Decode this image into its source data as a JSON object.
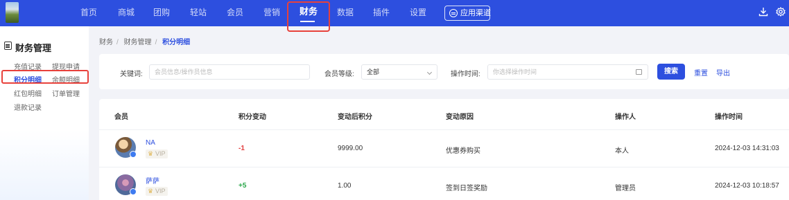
{
  "nav": {
    "items": [
      "首页",
      "商城",
      "团购",
      "轻站",
      "会员",
      "营销",
      "财务",
      "数据",
      "插件",
      "设置"
    ],
    "active": "财务",
    "channel_button": "应用渠道",
    "icons": [
      "download-icon",
      "gear-icon"
    ]
  },
  "sidebar": {
    "title": "财务管理",
    "links": [
      "充值记录",
      "提现申请",
      "积分明细",
      "余额明细",
      "红包明细",
      "订单管理",
      "退款记录"
    ],
    "active": "积分明细"
  },
  "breadcrumb": [
    "财务",
    "财务管理",
    "积分明细"
  ],
  "filters": {
    "keyword_label": "关键词:",
    "keyword_placeholder": "会员信息/操作员信息",
    "level_label": "会员等级:",
    "level_value": "全部",
    "time_label": "操作时间:",
    "time_placeholder": "你选择操作时间",
    "search_button": "搜索",
    "reset_button": "重置",
    "export_button": "导出"
  },
  "table": {
    "headers": [
      "会员",
      "积分变动",
      "变动后积分",
      "变动原因",
      "操作人",
      "操作时间"
    ],
    "rows": [
      {
        "name": "NA",
        "vip": "VIP",
        "change": "-1",
        "after": "9999.00",
        "reason": "优惠券购买",
        "operator": "本人",
        "time": "2024-12-03 14:31:03"
      },
      {
        "name": "萨萨",
        "vip": "VIP",
        "change": "+5",
        "after": "1.00",
        "reason": "签到日签奖励",
        "operator": "管理员",
        "time": "2024-12-03 10:18:57"
      }
    ]
  },
  "colors": {
    "brand": "#2d4fdf",
    "negative": "#e23c3c",
    "positive": "#29a74a",
    "highlight": "#e8413b"
  }
}
